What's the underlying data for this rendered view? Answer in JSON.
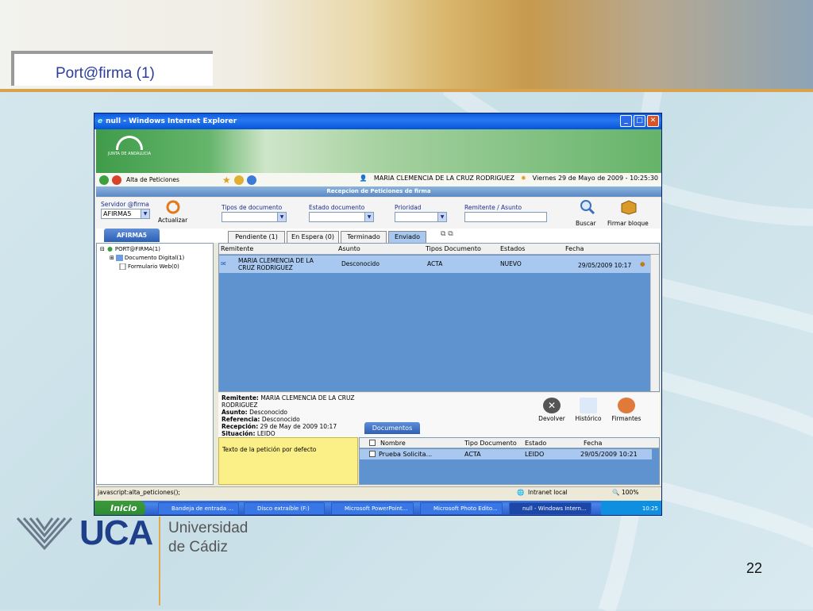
{
  "slide": {
    "title": "Port@firma (1)",
    "page_number": "22",
    "university_short": "UCA",
    "university_line1": "Universidad",
    "university_line2": "de Cádiz"
  },
  "browser": {
    "title": "null - Windows Internet Explorer",
    "status_left": "javascript:alta_peticiones();",
    "status_zone": "Intranet local",
    "zoom": "100%"
  },
  "app": {
    "logo_text": "JUNTA DE ANDALUCIA",
    "menu_alta": "Alta de Peticiones",
    "user_name": "MARIA CLEMENCIA DE LA CRUZ RODRIGUEZ",
    "date_text": "Viernes 29 de Mayo de 2009 - 10:25:30",
    "section_title": "Recepcion de Peticiones de firma",
    "server_label": "Servidor @firma",
    "server_value": "AFIRMA5",
    "update_label": "Actualizar",
    "filter_tipo": "Tipos de documento",
    "filter_estado": "Estado documento",
    "filter_prioridad": "Prioridad",
    "filter_remitente": "Remitente / Asunto",
    "search_label": "Buscar",
    "sign_label": "Firmar bloque",
    "left_tab": "AFIRMA5",
    "tabs": [
      "Pendiente (1)",
      "En Espera (0)",
      "Terminado",
      "Enviado"
    ],
    "tree": {
      "root": "PORT@FIRMA(1)",
      "child1": "Documento Digital(1)",
      "child2": "Formulario Web(0)"
    },
    "grid_headers": [
      "Remitente",
      "Asunto",
      "Tipos Documento",
      "Estados",
      "Fecha"
    ],
    "grid_row": {
      "remitente": "MARIA CLEMENCIA DE LA CRUZ RODRIGUEZ",
      "asunto": "Desconocido",
      "tipo": "ACTA",
      "estado": "NUEVO",
      "fecha": "29/05/2009 10:17"
    },
    "detail": {
      "remitente_label": "Remitente:",
      "remitente_value": "MARIA CLEMENCIA DE LA CRUZ RODRIGUEZ",
      "asunto_label": "Asunto:",
      "asunto_value": "Desconocido",
      "referencia_label": "Referencia:",
      "referencia_value": "Desconocido",
      "recepcion_label": "Recepción:",
      "recepcion_value": "29 de May de 2009 10:17",
      "situacion_label": "Situación:",
      "situacion_value": "LEIDO"
    },
    "actions": [
      "Devolver",
      "Histórico",
      "Firmantes"
    ],
    "documents_tab": "Documentos",
    "note_text": "Texto de la petición por defecto",
    "doc_headers": [
      "Nombre",
      "Tipo Documento",
      "Estado",
      "Fecha"
    ],
    "doc_row": {
      "nombre": "Prueba Solicita...",
      "tipo": "ACTA",
      "estado": "LEIDO",
      "fecha": "29/05/2009 10:21"
    }
  },
  "taskbar": {
    "start": "Inicio",
    "items": [
      "Bandeja de entrada ...",
      "Disco extraíble (F:)",
      "Microsoft PowerPoint...",
      "Microsoft Photo Edito...",
      "null - Windows Intern..."
    ],
    "clock": "10:25"
  }
}
